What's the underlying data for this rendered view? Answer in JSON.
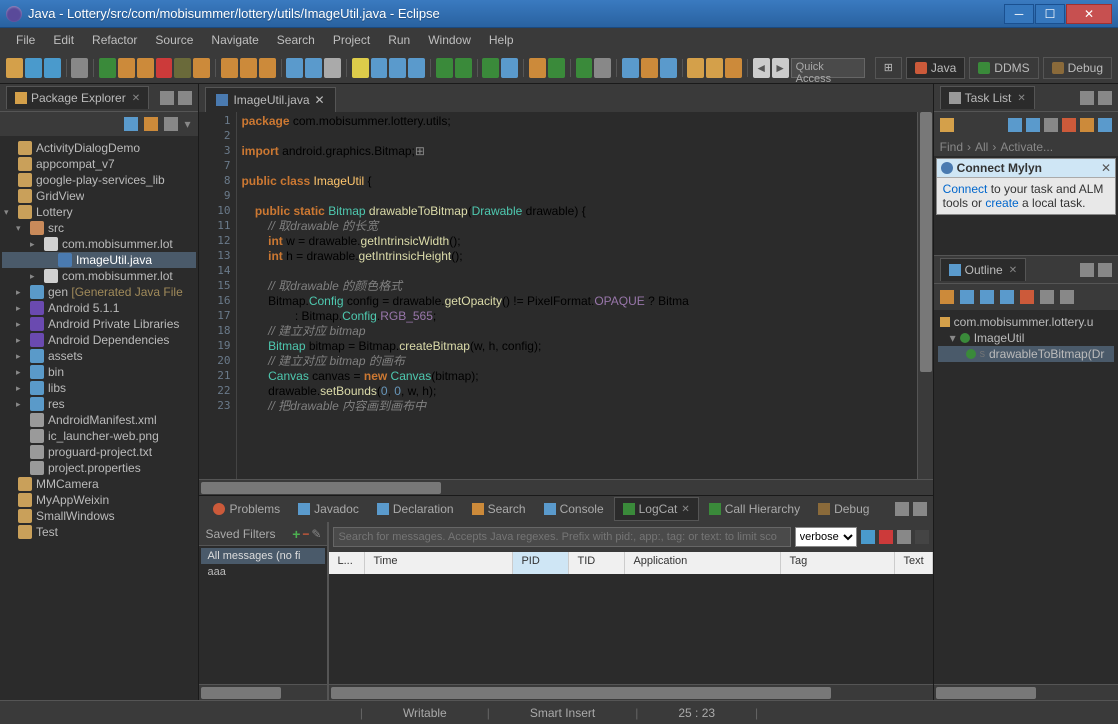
{
  "window": {
    "title": "Java - Lottery/src/com/mobisummer/lottery/utils/ImageUtil.java - Eclipse"
  },
  "menu": {
    "file": "File",
    "edit": "Edit",
    "refactor": "Refactor",
    "source": "Source",
    "navigate": "Navigate",
    "search": "Search",
    "project": "Project",
    "run": "Run",
    "window": "Window",
    "help": "Help"
  },
  "quickAccess": {
    "placeholder": "Quick Access"
  },
  "perspectives": {
    "java": "Java",
    "ddms": "DDMS",
    "debug": "Debug"
  },
  "packageExplorer": {
    "title": "Package Explorer",
    "items": [
      {
        "l": 0,
        "i": "i-proj",
        "t": "ActivityDialogDemo"
      },
      {
        "l": 0,
        "i": "i-proj",
        "t": "appcompat_v7"
      },
      {
        "l": 0,
        "i": "i-proj",
        "t": "google-play-services_lib"
      },
      {
        "l": 0,
        "i": "i-proj",
        "t": "GridView"
      },
      {
        "l": 0,
        "i": "i-proj",
        "t": "Lottery",
        "exp": "▾"
      },
      {
        "l": 1,
        "i": "i-src",
        "t": "src",
        "exp": "▾"
      },
      {
        "l": 2,
        "i": "i-pkg",
        "t": "com.mobisummer.lot",
        "exp": "▸"
      },
      {
        "l": 3,
        "i": "i-java",
        "t": "ImageUtil.java",
        "sel": true
      },
      {
        "l": 2,
        "i": "i-pkg",
        "t": "com.mobisummer.lot",
        "exp": "▸"
      },
      {
        "l": 1,
        "i": "i-folder",
        "t": "gen",
        "dim": "[Generated Java File",
        "exp": "▸"
      },
      {
        "l": 1,
        "i": "i-lib",
        "t": "Android 5.1.1",
        "exp": "▸"
      },
      {
        "l": 1,
        "i": "i-lib",
        "t": "Android Private Libraries",
        "exp": "▸"
      },
      {
        "l": 1,
        "i": "i-lib",
        "t": "Android Dependencies",
        "exp": "▸"
      },
      {
        "l": 1,
        "i": "i-folder",
        "t": "assets",
        "exp": "▸"
      },
      {
        "l": 1,
        "i": "i-folder",
        "t": "bin",
        "exp": "▸"
      },
      {
        "l": 1,
        "i": "i-folder",
        "t": "libs",
        "exp": "▸"
      },
      {
        "l": 1,
        "i": "i-folder",
        "t": "res",
        "exp": "▸"
      },
      {
        "l": 1,
        "i": "i-file",
        "t": "AndroidManifest.xml"
      },
      {
        "l": 1,
        "i": "i-file",
        "t": "ic_launcher-web.png"
      },
      {
        "l": 1,
        "i": "i-file",
        "t": "proguard-project.txt"
      },
      {
        "l": 1,
        "i": "i-file",
        "t": "project.properties"
      },
      {
        "l": 0,
        "i": "i-proj",
        "t": "MMCamera"
      },
      {
        "l": 0,
        "i": "i-proj",
        "t": "MyAppWeixin"
      },
      {
        "l": 0,
        "i": "i-proj",
        "t": "SmallWindows"
      },
      {
        "l": 0,
        "i": "i-proj",
        "t": "Test"
      }
    ]
  },
  "editor": {
    "tab": "ImageUtil.java",
    "lines": [
      {
        "n": "1",
        "html": "<span class='kw'>package</span> com.mobisummer.lottery.utils;"
      },
      {
        "n": "2",
        "html": ""
      },
      {
        "n": "3",
        "html": "<span class='kw'>import</span> android.graphics.Bitmap;<span style='color:#888'>⊞</span>"
      },
      {
        "n": "7",
        "html": ""
      },
      {
        "n": "8",
        "html": "<span class='kw'>public</span> <span class='kw'>class</span> <span class='cls'>ImageUtil</span> {"
      },
      {
        "n": "9",
        "html": ""
      },
      {
        "n": "10",
        "html": "    <span class='kw'>public</span> <span class='kw'>static</span> <span class='typ'>Bitmap</span> <span class='mth'>drawableToBitmap</span>(<span class='typ'>Drawable</span> drawable) {"
      },
      {
        "n": "11",
        "html": "        <span class='com'>// 取drawable 的长宽</span>"
      },
      {
        "n": "12",
        "html": "        <span class='kw'>int</span> w = drawable.<span class='mth'>getIntrinsicWidth</span>();"
      },
      {
        "n": "13",
        "html": "        <span class='kw'>int</span> h = drawable.<span class='mth'>getIntrinsicHeight</span>();"
      },
      {
        "n": "14",
        "html": ""
      },
      {
        "n": "15",
        "html": "        <span class='com'>// 取drawable 的颜色格式</span>"
      },
      {
        "n": "16",
        "html": "        Bitmap.<span class='typ'>Config</span> config = drawable.<span class='mth'>getOpacity</span>() != PixelFormat.<span class='fld'>OPAQUE</span> ? Bitma"
      },
      {
        "n": "17",
        "html": "                : Bitmap.<span class='typ'>Config</span>.<span class='fld'>RGB_565</span>;"
      },
      {
        "n": "18",
        "html": "        <span class='com'>// 建立对应 bitmap</span>"
      },
      {
        "n": "19",
        "html": "        <span class='typ'>Bitmap</span> bitmap = Bitmap.<span class='mth'>createBitmap</span>(w, h, config);"
      },
      {
        "n": "20",
        "html": "        <span class='com'>// 建立对应 bitmap 的画布</span>"
      },
      {
        "n": "21",
        "html": "        <span class='typ'>Canvas</span> canvas = <span class='kw'>new</span> <span class='typ'>Canvas</span>(bitmap);"
      },
      {
        "n": "22",
        "html": "        drawable.<span class='mth'>setBounds</span>(<span class='num'>0</span>, <span class='num'>0</span>, w, h);"
      },
      {
        "n": "23",
        "html": "        <span class='com'>// 把drawable 内容画到画布中</span>"
      }
    ]
  },
  "bottomTabs": {
    "problems": "Problems",
    "javadoc": "Javadoc",
    "declaration": "Declaration",
    "search": "Search",
    "console": "Console",
    "logcat": "LogCat",
    "callHierarchy": "Call Hierarchy",
    "debug": "Debug"
  },
  "logcat": {
    "savedFilters": "Saved Filters",
    "allMessages": "All messages (no fi",
    "filter_aaa": "aaa",
    "searchPlaceholder": "Search for messages. Accepts Java regexes. Prefix with pid:, app:, tag: or text: to limit sco",
    "level": "verbose",
    "columns": {
      "l": "L...",
      "time": "Time",
      "pid": "PID",
      "tid": "TID",
      "app": "Application",
      "tag": "Tag",
      "text": "Text"
    }
  },
  "taskList": {
    "title": "Task List",
    "find": "Find",
    "all": "All",
    "activate": "Activate..."
  },
  "mylyn": {
    "title": "Connect Mylyn",
    "connect": "Connect",
    "body1": " to your task and ALM tools or ",
    "create": "create",
    "body2": " a local task."
  },
  "outline": {
    "title": "Outline",
    "pkg": "com.mobisummer.lottery.u",
    "cls": "ImageUtil",
    "method": "drawableToBitmap(Dr"
  },
  "status": {
    "writable": "Writable",
    "insert": "Smart Insert",
    "pos": "25 : 23"
  }
}
